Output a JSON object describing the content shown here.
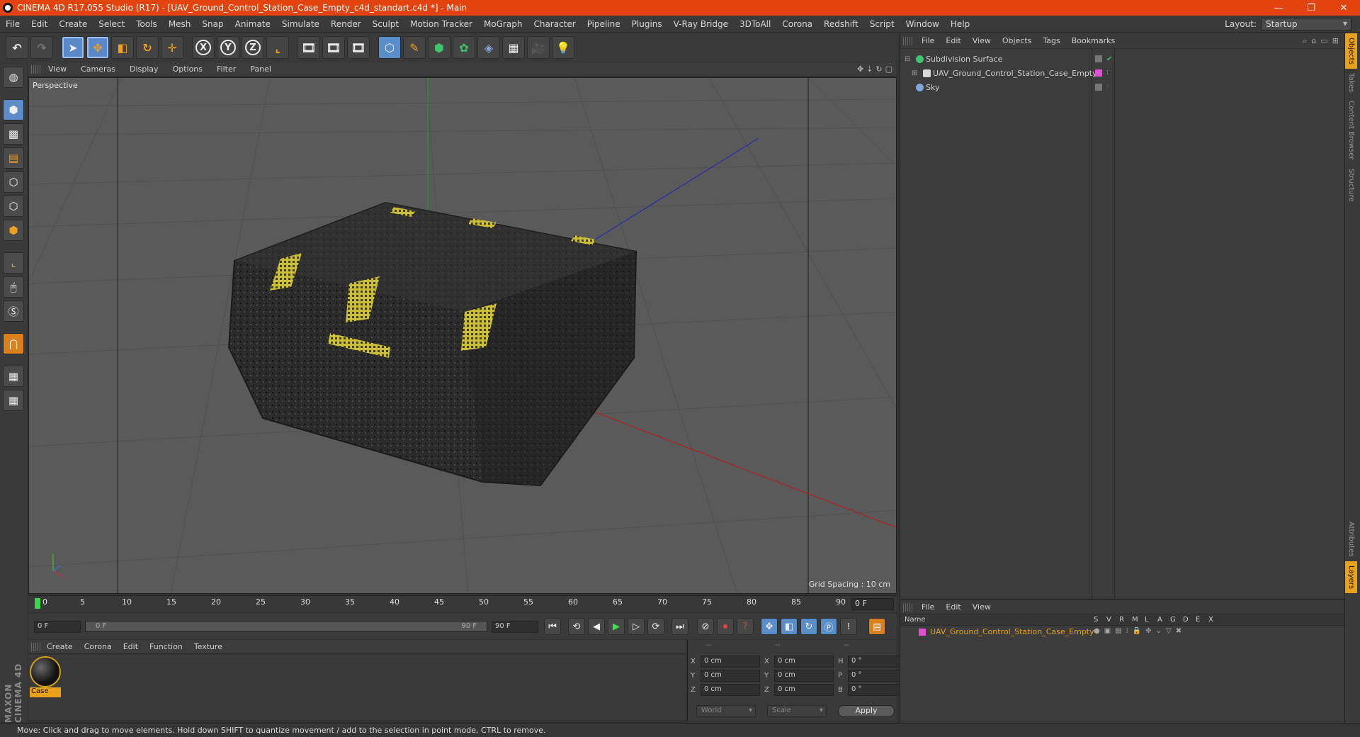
{
  "window": {
    "title": "CINEMA 4D R17.055 Studio (R17) - [UAV_Ground_Control_Station_Case_Empty_c4d_standart.c4d *] - Main",
    "controls": [
      "—",
      "❐",
      "✕"
    ]
  },
  "menubar": {
    "items": [
      "File",
      "Edit",
      "Create",
      "Select",
      "Tools",
      "Mesh",
      "Snap",
      "Animate",
      "Simulate",
      "Render",
      "Sculpt",
      "Motion Tracker",
      "MoGraph",
      "Character",
      "Pipeline",
      "Plugins",
      "V-Ray Bridge",
      "3DToAll",
      "Corona",
      "Redshift",
      "Script",
      "Window",
      "Help"
    ],
    "layout_label": "Layout:",
    "layout_value": "Startup"
  },
  "toolbar": {
    "axis_x": "X",
    "axis_y": "Y",
    "axis_z": "Z"
  },
  "viewport": {
    "menu": [
      "View",
      "Cameras",
      "Display",
      "Options",
      "Filter",
      "Panel"
    ],
    "label": "Perspective",
    "grid_spacing": "Grid Spacing : 10 cm"
  },
  "timeline": {
    "ticks": [
      "0",
      "5",
      "10",
      "15",
      "20",
      "25",
      "30",
      "35",
      "40",
      "45",
      "50",
      "55",
      "60",
      "65",
      "70",
      "75",
      "80",
      "85",
      "90"
    ],
    "current_frame": "0 F",
    "start_field": "0 F",
    "range_start": "0 F",
    "range_end": "90 F",
    "end_field": "90 F"
  },
  "material_manager": {
    "menu": [
      "Create",
      "Corona",
      "Edit",
      "Function",
      "Texture"
    ],
    "materials": [
      {
        "name": "Case"
      }
    ]
  },
  "coordinates": {
    "headers": [
      "--",
      "--",
      "--"
    ],
    "rows": [
      {
        "a": "X",
        "av": "0 cm",
        "b": "X",
        "bv": "0 cm",
        "c": "H",
        "cv": "0 °"
      },
      {
        "a": "Y",
        "av": "0 cm",
        "b": "Y",
        "bv": "0 cm",
        "c": "P",
        "cv": "0 °"
      },
      {
        "a": "Z",
        "av": "0 cm",
        "b": "Z",
        "bv": "0 cm",
        "c": "B",
        "cv": "0 °"
      }
    ],
    "mode": "World",
    "scale": "Scale",
    "apply": "Apply"
  },
  "object_manager": {
    "menu": [
      "File",
      "Edit",
      "View",
      "Objects",
      "Tags",
      "Bookmarks"
    ],
    "objects": [
      {
        "name": "Subdivision Surface",
        "icon_color": "#3ec46d"
      },
      {
        "name": "UAV_Ground_Control_Station_Case_Empty",
        "icon_color": "#d8d8d8"
      },
      {
        "name": "Sky",
        "icon_color": "#7fa8d8"
      }
    ]
  },
  "side_tabs": [
    "Objects",
    "Takes",
    "Content Browser",
    "Structure",
    "Attributes",
    "Layers"
  ],
  "layer_manager": {
    "menu": [
      "File",
      "Edit",
      "View"
    ],
    "columns": [
      "Name",
      "S",
      "V",
      "R",
      "M",
      "L",
      "A",
      "G",
      "D",
      "E",
      "X"
    ],
    "layers": [
      {
        "name": "UAV_Ground_Control_Station_Case_Empty",
        "color": "#e050d0"
      }
    ]
  },
  "status": "Move: Click and drag to move elements. Hold down SHIFT to quantize movement / add to the selection in point mode, CTRL to remove.",
  "branding": "MAXON CINEMA 4D"
}
